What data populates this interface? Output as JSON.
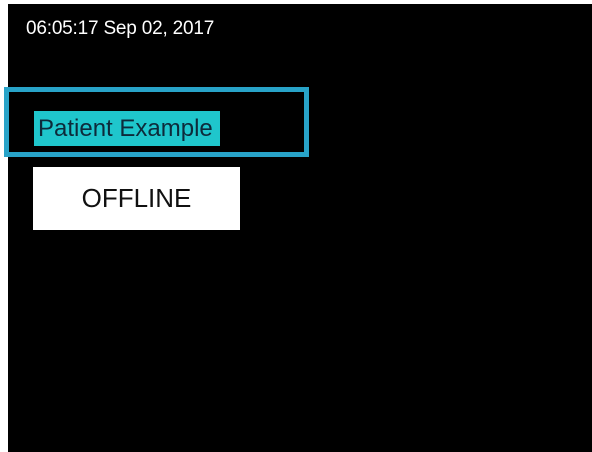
{
  "header": {
    "datetime": "06:05:17 Sep 02, 2017"
  },
  "patient": {
    "name": "Patient Example",
    "selected": true
  },
  "status": {
    "label": "OFFLINE"
  },
  "colors": {
    "background": "#000000",
    "selection_border": "#28a3c8",
    "name_highlight": "#1fc6cc",
    "status_background": "#ffffff"
  }
}
